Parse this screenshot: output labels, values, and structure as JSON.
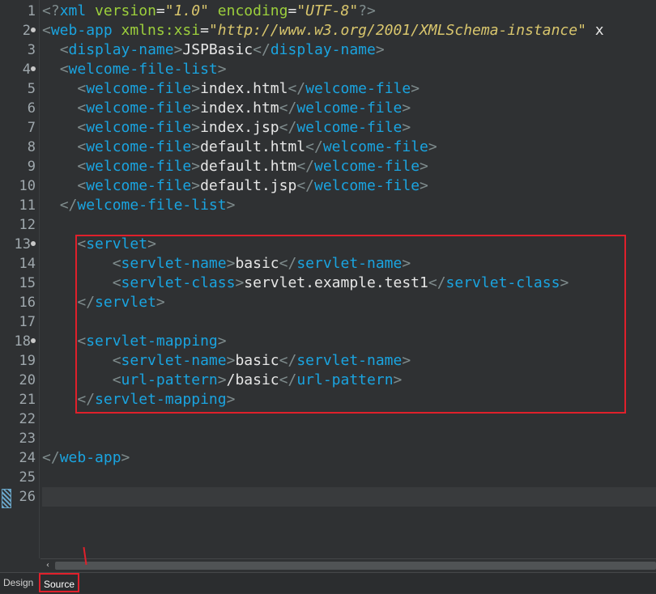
{
  "editor": {
    "line_numbers": [
      "1",
      "2",
      "3",
      "4",
      "5",
      "6",
      "7",
      "8",
      "9",
      "10",
      "11",
      "12",
      "13",
      "14",
      "15",
      "16",
      "17",
      "18",
      "19",
      "20",
      "21",
      "22",
      "23",
      "24",
      "25",
      "26"
    ],
    "folding_markers_on_lines": [
      "2",
      "4",
      "13",
      "18"
    ],
    "lines": [
      [
        [
          "p",
          "<?"
        ],
        [
          "t",
          "xml "
        ],
        [
          "a",
          "version"
        ],
        [
          "x",
          "="
        ],
        [
          "v",
          "\"1.0\""
        ],
        [
          "x",
          " "
        ],
        [
          "a",
          "encoding"
        ],
        [
          "x",
          "="
        ],
        [
          "v",
          "\"UTF-8\""
        ],
        [
          "p",
          "?>"
        ]
      ],
      [
        [
          "p",
          "<"
        ],
        [
          "t",
          "web-app "
        ],
        [
          "a",
          "xmlns:xsi"
        ],
        [
          "x",
          "="
        ],
        [
          "v",
          "\"http://www.w3.org/2001/XMLSchema-instance\""
        ],
        [
          "x",
          " x"
        ]
      ],
      [
        [
          "x",
          "  "
        ],
        [
          "p",
          "<"
        ],
        [
          "t",
          "display-name"
        ],
        [
          "p",
          ">"
        ],
        [
          "x",
          "JSPBasic"
        ],
        [
          "p",
          "</"
        ],
        [
          "t",
          "display-name"
        ],
        [
          "p",
          ">"
        ]
      ],
      [
        [
          "x",
          "  "
        ],
        [
          "p",
          "<"
        ],
        [
          "t",
          "welcome-file-list"
        ],
        [
          "p",
          ">"
        ]
      ],
      [
        [
          "x",
          "    "
        ],
        [
          "p",
          "<"
        ],
        [
          "t",
          "welcome-file"
        ],
        [
          "p",
          ">"
        ],
        [
          "x",
          "index.html"
        ],
        [
          "p",
          "</"
        ],
        [
          "t",
          "welcome-file"
        ],
        [
          "p",
          ">"
        ]
      ],
      [
        [
          "x",
          "    "
        ],
        [
          "p",
          "<"
        ],
        [
          "t",
          "welcome-file"
        ],
        [
          "p",
          ">"
        ],
        [
          "x",
          "index.htm"
        ],
        [
          "p",
          "</"
        ],
        [
          "t",
          "welcome-file"
        ],
        [
          "p",
          ">"
        ]
      ],
      [
        [
          "x",
          "    "
        ],
        [
          "p",
          "<"
        ],
        [
          "t",
          "welcome-file"
        ],
        [
          "p",
          ">"
        ],
        [
          "x",
          "index.jsp"
        ],
        [
          "p",
          "</"
        ],
        [
          "t",
          "welcome-file"
        ],
        [
          "p",
          ">"
        ]
      ],
      [
        [
          "x",
          "    "
        ],
        [
          "p",
          "<"
        ],
        [
          "t",
          "welcome-file"
        ],
        [
          "p",
          ">"
        ],
        [
          "x",
          "default.html"
        ],
        [
          "p",
          "</"
        ],
        [
          "t",
          "welcome-file"
        ],
        [
          "p",
          ">"
        ]
      ],
      [
        [
          "x",
          "    "
        ],
        [
          "p",
          "<"
        ],
        [
          "t",
          "welcome-file"
        ],
        [
          "p",
          ">"
        ],
        [
          "x",
          "default.htm"
        ],
        [
          "p",
          "</"
        ],
        [
          "t",
          "welcome-file"
        ],
        [
          "p",
          ">"
        ]
      ],
      [
        [
          "x",
          "    "
        ],
        [
          "p",
          "<"
        ],
        [
          "t",
          "welcome-file"
        ],
        [
          "p",
          ">"
        ],
        [
          "x",
          "default.jsp"
        ],
        [
          "p",
          "</"
        ],
        [
          "t",
          "welcome-file"
        ],
        [
          "p",
          ">"
        ]
      ],
      [
        [
          "x",
          "  "
        ],
        [
          "p",
          "</"
        ],
        [
          "t",
          "welcome-file-list"
        ],
        [
          "p",
          ">"
        ]
      ],
      [],
      [
        [
          "x",
          "    "
        ],
        [
          "p",
          "<"
        ],
        [
          "t",
          "servlet"
        ],
        [
          "p",
          ">"
        ]
      ],
      [
        [
          "x",
          "        "
        ],
        [
          "p",
          "<"
        ],
        [
          "t",
          "servlet-name"
        ],
        [
          "p",
          ">"
        ],
        [
          "x",
          "basic"
        ],
        [
          "p",
          "</"
        ],
        [
          "t",
          "servlet-name"
        ],
        [
          "p",
          ">"
        ]
      ],
      [
        [
          "x",
          "        "
        ],
        [
          "p",
          "<"
        ],
        [
          "t",
          "servlet-class"
        ],
        [
          "p",
          ">"
        ],
        [
          "x",
          "servlet.example.test1"
        ],
        [
          "p",
          "</"
        ],
        [
          "t",
          "servlet-class"
        ],
        [
          "p",
          ">"
        ]
      ],
      [
        [
          "x",
          "    "
        ],
        [
          "p",
          "</"
        ],
        [
          "t",
          "servlet"
        ],
        [
          "p",
          ">"
        ]
      ],
      [],
      [
        [
          "x",
          "    "
        ],
        [
          "p",
          "<"
        ],
        [
          "t",
          "servlet-mapping"
        ],
        [
          "p",
          ">"
        ]
      ],
      [
        [
          "x",
          "        "
        ],
        [
          "p",
          "<"
        ],
        [
          "t",
          "servlet-name"
        ],
        [
          "p",
          ">"
        ],
        [
          "x",
          "basic"
        ],
        [
          "p",
          "</"
        ],
        [
          "t",
          "servlet-name"
        ],
        [
          "p",
          ">"
        ]
      ],
      [
        [
          "x",
          "        "
        ],
        [
          "p",
          "<"
        ],
        [
          "t",
          "url-pattern"
        ],
        [
          "p",
          ">"
        ],
        [
          "x",
          "/basic"
        ],
        [
          "p",
          "</"
        ],
        [
          "t",
          "url-pattern"
        ],
        [
          "p",
          ">"
        ]
      ],
      [
        [
          "x",
          "    "
        ],
        [
          "p",
          "</"
        ],
        [
          "t",
          "servlet-mapping"
        ],
        [
          "p",
          ">"
        ]
      ],
      [],
      [],
      [
        [
          "p",
          "</"
        ],
        [
          "t",
          "web-app"
        ],
        [
          "p",
          ">"
        ]
      ],
      [],
      []
    ]
  },
  "scrollbar": {
    "left_arrow": "‹"
  },
  "tabs": {
    "design_label": "Design",
    "source_label": "Source",
    "active": "Source"
  },
  "colors": {
    "background": "#2f3133",
    "tag": "#1aa4e0",
    "attribute": "#9ccf3c",
    "value": "#d9c66d",
    "punctuation": "#7f8c8d",
    "text": "#e6e6e6",
    "annotation_red": "#e0202b"
  }
}
